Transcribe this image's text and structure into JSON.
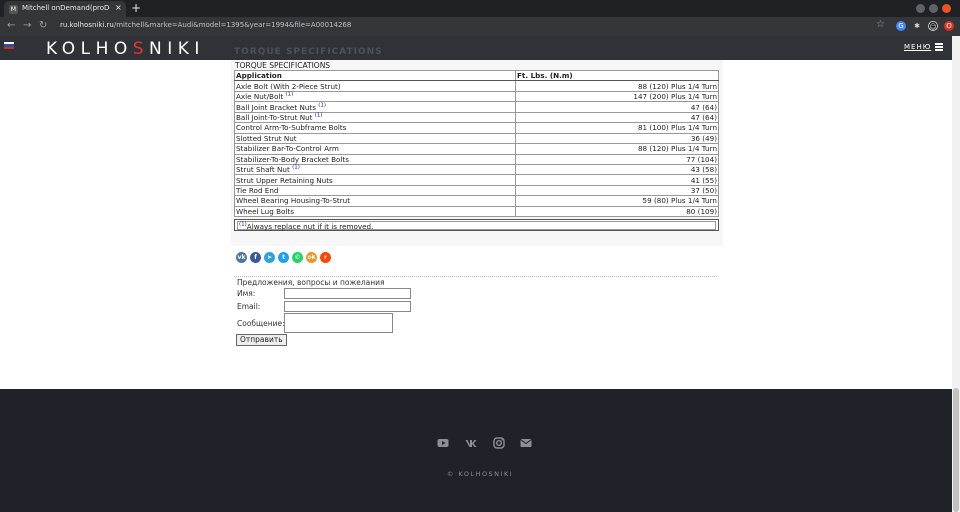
{
  "browser": {
    "tab_title": "Mitchell onDemand(proDe",
    "tab_close": "×",
    "new_tab": "+",
    "url_domain": "ru.kolhosniki.ru",
    "url_path": "/mitchell&marke=Audi&model=1395&year=1994&file=A00014268"
  },
  "header": {
    "logo_prefix": "KOLHO",
    "logo_accent": "S",
    "logo_suffix": "NIKI",
    "menu_label": "МЕНЮ",
    "accent_color": "#e8352b"
  },
  "content": {
    "ghost_title": "TORQUE SPECIFICATIONS",
    "section_title": "TORQUE SPECIFICATIONS",
    "table": {
      "headers": [
        "Application",
        "Ft. Lbs. (N.m)"
      ],
      "rows": [
        {
          "application": "Axle Bolt (With 2-Piece Strut)",
          "note": "",
          "value": "88 (120) Plus 1/4 Turn"
        },
        {
          "application": "Axle Nut/Bolt",
          "note": "(1)",
          "value": "147 (200) Plus 1/4 Turn"
        },
        {
          "application": "Ball Joint Bracket Nuts",
          "note": "(1)",
          "value": "47 (64)"
        },
        {
          "application": "Ball Joint-To-Strut Nut",
          "note": "(1)",
          "value": "47 (64)"
        },
        {
          "application": "Control Arm-To-Subframe Bolts",
          "note": "",
          "value": "81 (100) Plus 1/4 Turn"
        },
        {
          "application": "Slotted Strut Nut",
          "note": "",
          "value": "36 (49)"
        },
        {
          "application": "Stabilizer Bar-To-Control Arm",
          "note": "",
          "value": "88 (120) Plus 1/4 Turn"
        },
        {
          "application": "Stabilizer-To-Body Bracket Bolts",
          "note": "",
          "value": "77 (104)"
        },
        {
          "application": "Strut Shaft Nut",
          "note": "(1)",
          "value": "43 (58)"
        },
        {
          "application": "Strut Upper Retaining Nuts",
          "note": "",
          "value": "41 (55)"
        },
        {
          "application": "Tie Rod End",
          "note": "",
          "value": "37 (50)"
        },
        {
          "application": "Wheel Bearing Housing-To-Strut",
          "note": "",
          "value": "59 (80) Plus 1/4 Turn"
        },
        {
          "application": "Wheel Lug Bolts",
          "note": "",
          "value": "80 (109)"
        }
      ],
      "footnote_marker": "(1)",
      "footnote_text": "Always replace nut if it is removed."
    }
  },
  "share_icons": [
    {
      "name": "vk-share-icon",
      "glyph": "vk",
      "color": "#4c75a3"
    },
    {
      "name": "facebook-share-icon",
      "glyph": "f",
      "color": "#3b5998"
    },
    {
      "name": "telegram-share-icon",
      "glyph": "➤",
      "color": "#2aa3de"
    },
    {
      "name": "twitter-share-icon",
      "glyph": "t",
      "color": "#1da1f2"
    },
    {
      "name": "whatsapp-share-icon",
      "glyph": "✆",
      "color": "#25d366"
    },
    {
      "name": "odnoklassniki-share-icon",
      "glyph": "ok",
      "color": "#f7931e"
    },
    {
      "name": "reddit-share-icon",
      "glyph": "r",
      "color": "#ff4500"
    }
  ],
  "form": {
    "title": "Предложения, вопросы и пожелания",
    "name_label": "Имя:",
    "email_label": "Email:",
    "message_label": "Сообщение:",
    "submit_label": "Отправить"
  },
  "footer": {
    "copyright": "© KOLHOSNIKI"
  }
}
